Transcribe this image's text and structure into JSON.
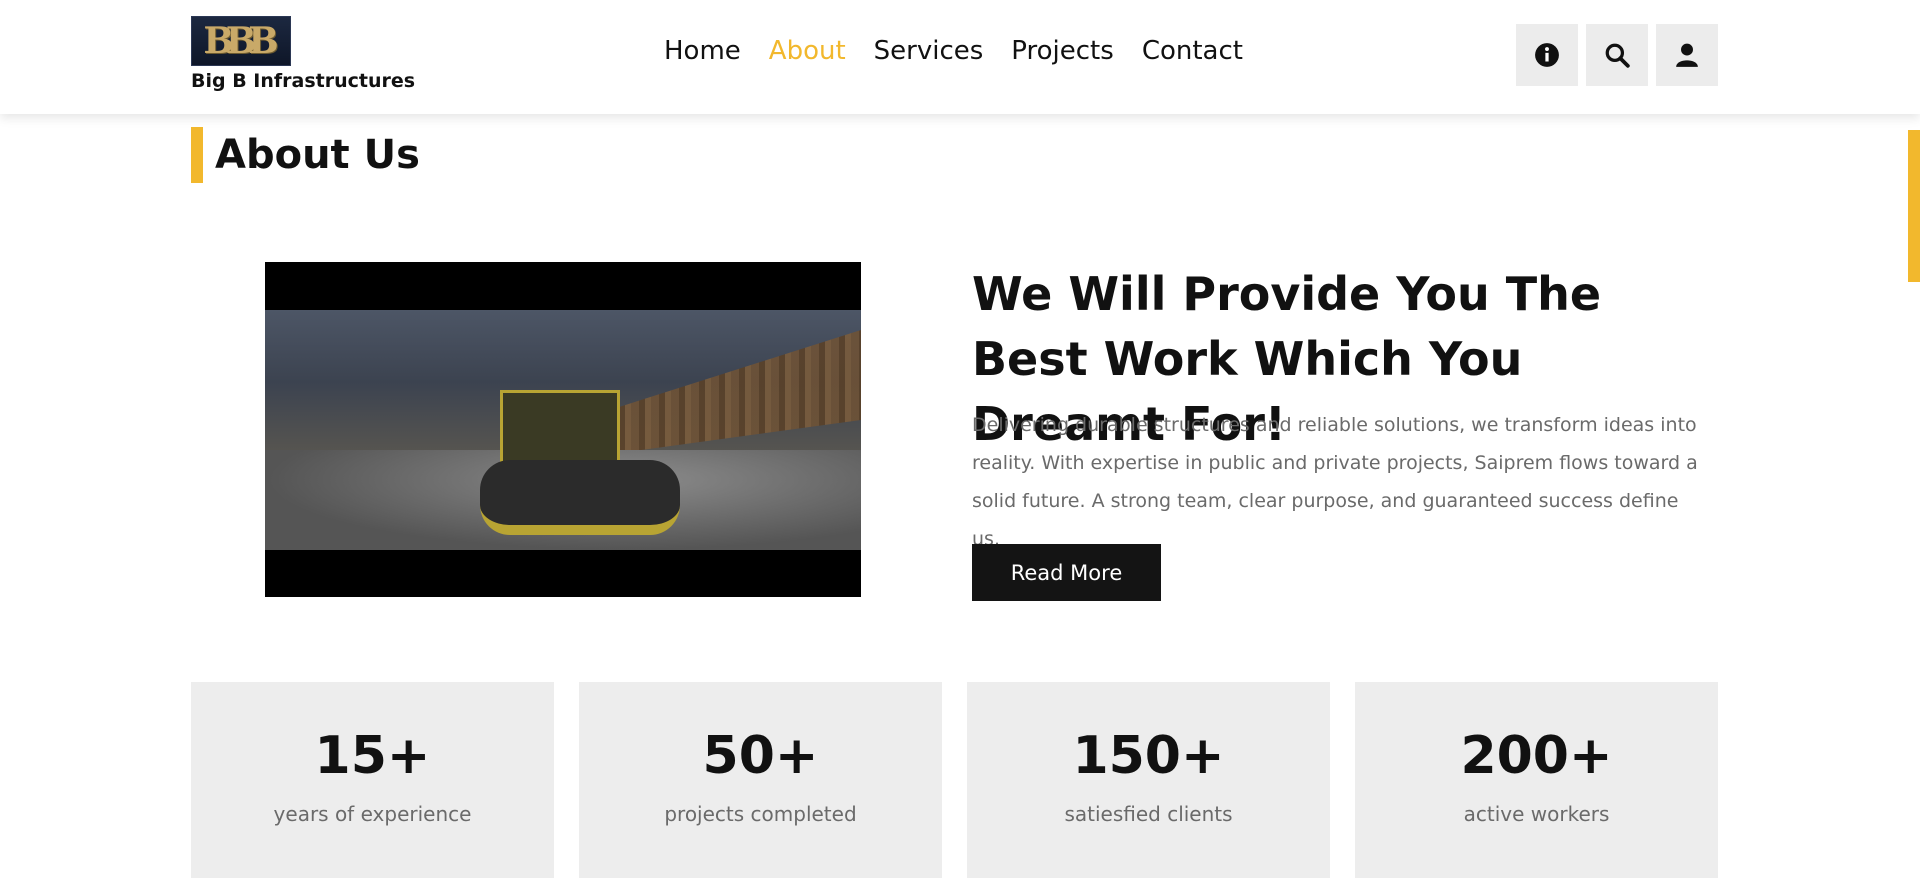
{
  "brand": {
    "logo_text": "BBB",
    "name": "Big B Infrastructures"
  },
  "nav": {
    "items": [
      {
        "label": "Home"
      },
      {
        "label": "About"
      },
      {
        "label": "Services"
      },
      {
        "label": "Projects"
      },
      {
        "label": "Contact"
      }
    ],
    "active": "About"
  },
  "header_icons": [
    "info-icon",
    "search-icon",
    "user-icon"
  ],
  "about": {
    "title": "About Us",
    "headline": "We Will Provide You The Best Work Which You Dreamt For!",
    "description": "Delivering durable structures and reliable solutions, we transform ideas into reality. With expertise in public and private projects, Saiprem flows toward a solid future. A strong team, clear purpose, and guaranteed success define us.",
    "read_more_label": "Read More"
  },
  "stats": [
    {
      "value": "15+",
      "label": "years of experience"
    },
    {
      "value": "50+",
      "label": "projects completed"
    },
    {
      "value": "150+",
      "label": "satiesfied clients"
    },
    {
      "value": "200+",
      "label": "active workers"
    }
  ],
  "colors": {
    "accent": "#f2b82d",
    "dark": "#141414",
    "muted": "#6a6a6a",
    "card": "#ededed"
  }
}
